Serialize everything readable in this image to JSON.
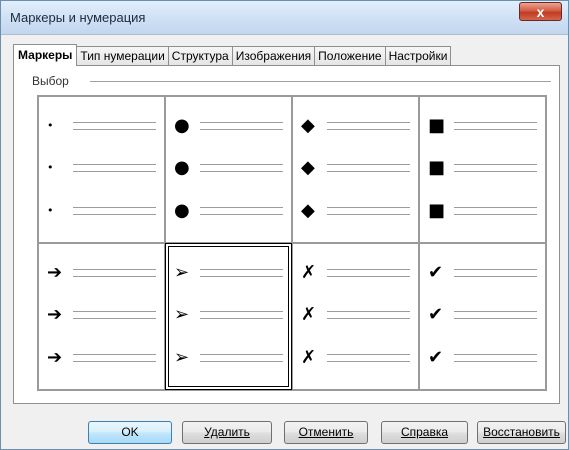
{
  "window": {
    "title": "Маркеры и нумерация",
    "close_glyph": "x"
  },
  "tabs": [
    {
      "label": "Маркеры",
      "active": true
    },
    {
      "label": "Тип нумерации",
      "active": false
    },
    {
      "label": "Структура",
      "active": false
    },
    {
      "label": "Изображения",
      "active": false
    },
    {
      "label": "Положение",
      "active": false
    },
    {
      "label": "Настройки",
      "active": false
    }
  ],
  "selection_group": {
    "label": "Выбор"
  },
  "bullets": [
    {
      "name": "dot-bullet",
      "glyph": "•"
    },
    {
      "name": "circle-bullet",
      "glyph": "●"
    },
    {
      "name": "diamond-bullet",
      "glyph": "◆"
    },
    {
      "name": "square-bullet",
      "glyph": "■"
    },
    {
      "name": "arrow-bullet",
      "glyph": "➔"
    },
    {
      "name": "triangle-arrow-bullet",
      "glyph": "➢",
      "selected": true
    },
    {
      "name": "cross-bullet",
      "glyph": "✗"
    },
    {
      "name": "checkmark-bullet",
      "glyph": "✔"
    }
  ],
  "buttons": {
    "ok": "OK",
    "delete": "Удалить",
    "cancel": "Отменить",
    "help": "Справка",
    "restore": "Восстановить"
  }
}
